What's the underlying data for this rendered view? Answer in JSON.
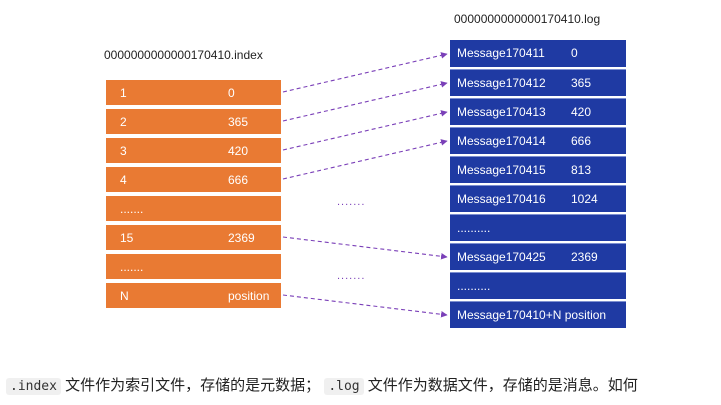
{
  "index_file": {
    "filename": "0000000000000170410.index",
    "rows": [
      {
        "key": "1",
        "value": "0"
      },
      {
        "key": "2",
        "value": "365"
      },
      {
        "key": "3",
        "value": "420"
      },
      {
        "key": "4",
        "value": "666"
      },
      {
        "key": ".......",
        "value": ""
      },
      {
        "key": "15",
        "value": "2369"
      },
      {
        "key": ".......",
        "value": ""
      },
      {
        "key": "N",
        "value": "position"
      }
    ]
  },
  "log_file": {
    "filename": "0000000000000170410.log",
    "rows": [
      {
        "message": "Message170411",
        "offset": "0"
      },
      {
        "message": "Message170412",
        "offset": "365"
      },
      {
        "message": "Message170413",
        "offset": "420"
      },
      {
        "message": "Message170414",
        "offset": "666"
      },
      {
        "message": "Message170415",
        "offset": "813"
      },
      {
        "message": "Message170416",
        "offset": "1024"
      },
      {
        "message": "..........",
        "offset": ""
      },
      {
        "message": "Message170425",
        "offset": "2369"
      },
      {
        "message": "..........",
        "offset": ""
      },
      {
        "message": "Message170410+N position",
        "offset": ""
      }
    ]
  },
  "gap_markers": [
    ".......",
    "......."
  ],
  "caption": {
    "code1": ".index",
    "text1": " 文件作为索引文件，存储的是元数据；",
    "code2": ".log",
    "text2": " 文件作为数据文件，存储的是消息。如何"
  },
  "colors": {
    "index_fill": "#e97a33",
    "log_fill": "#1f3aa3",
    "arrow": "#7a3fb8"
  }
}
